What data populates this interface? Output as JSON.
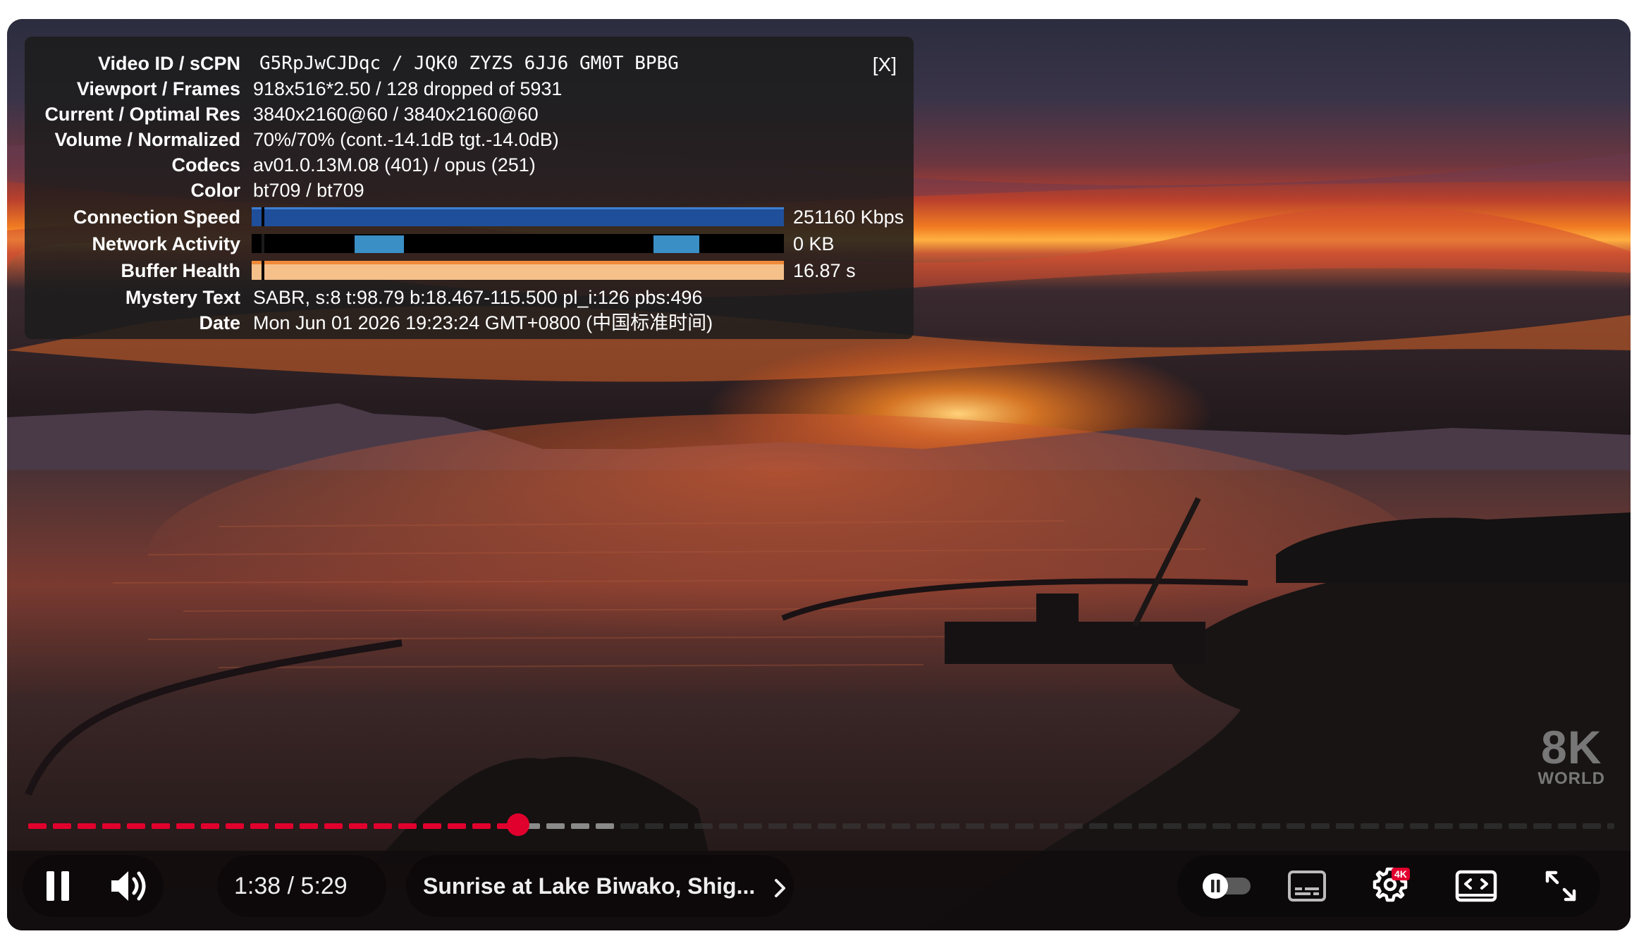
{
  "stats": {
    "close_label": "[X]",
    "rows": [
      {
        "label": "Video ID / sCPN",
        "value": "G5RpJwCJDqc / JQK0 ZYZS 6JJ6 GM0T BPBG"
      },
      {
        "label": "Viewport / Frames",
        "value": "918x516*2.50 / 128 dropped of 5931"
      },
      {
        "label": "Current / Optimal Res",
        "value": "3840x2160@60 / 3840x2160@60"
      },
      {
        "label": "Volume / Normalized",
        "value": "70%/70% (cont.-14.1dB tgt.-14.0dB)"
      },
      {
        "label": "Codecs",
        "value": "av01.0.13M.08 (401) / opus (251)"
      },
      {
        "label": "Color",
        "value": "bt709 / bt709"
      },
      {
        "label": "Connection Speed",
        "value": "251160 Kbps"
      },
      {
        "label": "Network Activity",
        "value": "0 KB"
      },
      {
        "label": "Buffer Health",
        "value": "16.87 s"
      },
      {
        "label": "Mystery Text",
        "value": "SABR, s:8 t:98.79 b:18.467-115.500 pl_i:126 pbs:496"
      },
      {
        "label": "Date",
        "value": "Mon Jun 01 2026 19:23:24 GMT+0800 (中国标准时间)"
      }
    ],
    "colors": {
      "connection": "#1f4f9a",
      "network": "#3a8fc5",
      "buffer": "#f5c08a"
    }
  },
  "watermark": {
    "big": "8K",
    "small": "WORLD"
  },
  "progress": {
    "played_fraction": 0.309,
    "buffered_fraction": 0.36,
    "played_color": "#e1002d",
    "buffered_color": "#8a8a8a"
  },
  "controls": {
    "current_time": "1:38",
    "separator": "/",
    "duration": "5:29",
    "video_title": "Sunrise at Lake Biwako, Shig...",
    "quality_badge": "4K",
    "icons": {
      "play_pause": "pause-icon",
      "volume": "volume-icon",
      "title_chevron": "chevron-right-icon",
      "autoplay": "autoplay-toggle-icon",
      "subtitles": "subtitles-icon",
      "settings": "gear-icon",
      "theater": "theater-mode-icon",
      "fullscreen": "fullscreen-icon"
    }
  }
}
